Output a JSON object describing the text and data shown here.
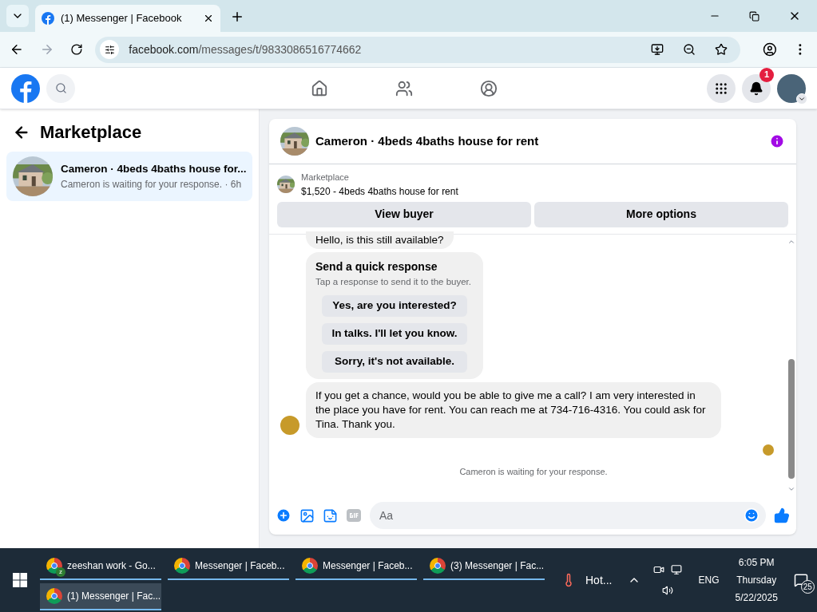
{
  "browser": {
    "tabs": [
      {
        "title": "(1) Messenger | Facebook",
        "selected": true
      }
    ],
    "url": {
      "host": "facebook.com",
      "path": "/messages/t/9833086516774662"
    }
  },
  "nav": {
    "notification_count": "1",
    "items": [
      {
        "kind": "home",
        "selected": false
      },
      {
        "kind": "friends",
        "selected": false
      },
      {
        "kind": "groups",
        "selected": false
      }
    ]
  },
  "sidebar": {
    "title": "Marketplace",
    "conversations": [
      {
        "title": "Cameron · 4beds 4baths house for...",
        "preview": "Cameron is waiting for your response.",
        "separator": "·",
        "time": "6h",
        "selected": true
      }
    ]
  },
  "chat": {
    "title": "Cameron · 4beds 4baths house for rent",
    "listing": {
      "label": "Marketplace",
      "title": "$1,520 - 4beds 4baths house for rent"
    },
    "buttons": [
      "View buyer",
      "More options"
    ],
    "messages": [
      {
        "kind": "text",
        "text": "Hello, is this still available?",
        "avatar": false
      },
      {
        "kind": "quick",
        "title": "Send a quick response",
        "subtitle": "Tap a response to send it to the buyer.",
        "options": [
          "Yes, are you interested?",
          "In talks. I'll let you know.",
          "Sorry, it's not available."
        ]
      },
      {
        "kind": "text",
        "text": "If you get a chance, would you be able to give me a call? I am very interested in the place you have for rent. You can reach me at 734-716-4316. You could ask for Tina. Thank you.",
        "avatar": true
      }
    ],
    "status": "Cameron is waiting for your response.",
    "composer": {
      "placeholder": "Aa"
    }
  },
  "taskbar": {
    "windows": [
      {
        "title": "zeeshan work - Go...",
        "badge": "z",
        "selected": false
      },
      {
        "title": "Messenger | Faceb...",
        "selected": false
      },
      {
        "title": "Messenger | Faceb...",
        "selected": false
      },
      {
        "title": "(3) Messenger | Fac...",
        "selected": false
      },
      {
        "title": "(1) Messenger | Fac...",
        "selected": true
      }
    ],
    "weather": "Hot...",
    "language": "ENG",
    "time": "6:05 PM",
    "day": "Thursday",
    "date": "5/22/2025",
    "notifications": "25"
  }
}
